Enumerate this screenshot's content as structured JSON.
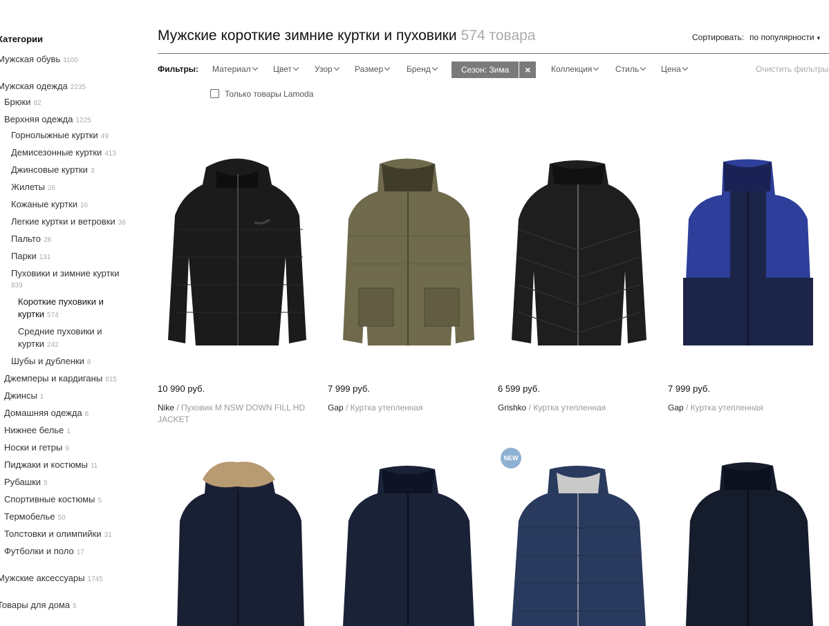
{
  "sidebar": {
    "title": "Категории",
    "items": [
      {
        "label": "Мужская обувь",
        "count": "1100"
      },
      {
        "label": "Мужская одежда",
        "count": "2235"
      },
      {
        "label": "Брюки",
        "count": "82"
      },
      {
        "label": "Верхняя одежда",
        "count": "1225"
      },
      {
        "label": "Горнолыжные куртки",
        "count": "49"
      },
      {
        "label": "Демисезонные куртки",
        "count": "413"
      },
      {
        "label": "Джинсовые куртки",
        "count": "3"
      },
      {
        "label": "Жилеты",
        "count": "26"
      },
      {
        "label": "Кожаные куртки",
        "count": "16"
      },
      {
        "label": "Легкие куртки и ветровки",
        "count": "38"
      },
      {
        "label": "Пальто",
        "count": "28"
      },
      {
        "label": "Парки",
        "count": "131"
      },
      {
        "label": "Пуховики и зимние куртки",
        "count": "839"
      },
      {
        "label": "Короткие пуховики и куртки",
        "count": "574"
      },
      {
        "label": "Средние пуховики и куртки",
        "count": "242"
      },
      {
        "label": "Шубы и дубленки",
        "count": "8"
      },
      {
        "label": "Джемперы и кардиганы",
        "count": "815"
      },
      {
        "label": "Джинсы",
        "count": "1"
      },
      {
        "label": "Домашняя одежда",
        "count": "6"
      },
      {
        "label": "Нижнее белье",
        "count": "1"
      },
      {
        "label": "Носки и гетры",
        "count": "9"
      },
      {
        "label": "Пиджаки и костюмы",
        "count": "11"
      },
      {
        "label": "Рубашки",
        "count": "5"
      },
      {
        "label": "Спортивные костюмы",
        "count": "5"
      },
      {
        "label": "Термобелье",
        "count": "50"
      },
      {
        "label": "Толстовки и олимпийки",
        "count": "31"
      },
      {
        "label": "Футболки и поло",
        "count": "17"
      },
      {
        "label": "Мужские аксессуары",
        "count": "1745"
      },
      {
        "label": "Товары для дома",
        "count": "5"
      }
    ]
  },
  "header": {
    "title": "Мужские короткие зимние куртки и пуховики",
    "count": "574 товара",
    "sort_label": "Сортировать:",
    "sort_value": "по популярности"
  },
  "filters": {
    "label": "Фильтры:",
    "items": [
      "Материал",
      "Цвет",
      "Узор",
      "Размер",
      "Бренд",
      "Коллекция",
      "Стиль",
      "Цена"
    ],
    "active": "Сезон: Зима",
    "remove": "×",
    "clear": "Очистить фильтры",
    "lamoda_only": "Только товары Lamoda"
  },
  "products": [
    {
      "price": "10 990 руб.",
      "brand": "Nike",
      "name": " / Пуховик M NSW DOWN FILL HD JACKET",
      "color": "#1b1b1b"
    },
    {
      "price": "7 999 руб.",
      "brand": "Gap",
      "name": " / Куртка утепленная",
      "color": "#6f6a4c"
    },
    {
      "price": "6 599 руб.",
      "brand": "Grishko",
      "name": " / Куртка утепленная",
      "color": "#1e1e1e"
    },
    {
      "price": "7 999 руб.",
      "brand": "Gap",
      "name": " / Куртка утепленная",
      "color": "#2d3f9a"
    },
    {
      "price": "",
      "brand": "",
      "name": "",
      "color": "#1a2033"
    },
    {
      "price": "",
      "brand": "",
      "name": "",
      "color": "#1a2238"
    },
    {
      "price": "",
      "brand": "",
      "name": "",
      "color": "#2a3a5e",
      "badge": "NEW"
    },
    {
      "price": "",
      "brand": "",
      "name": "",
      "color": "#151c2c"
    }
  ]
}
